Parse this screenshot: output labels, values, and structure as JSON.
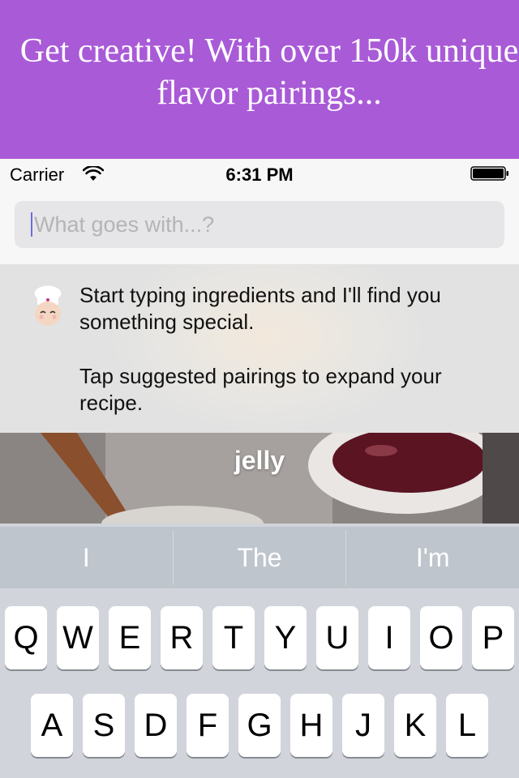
{
  "banner": {
    "text": "Get creative! With over 150k unique flavor pairings..."
  },
  "status_bar": {
    "carrier": "Carrier",
    "time": "6:31 PM"
  },
  "search": {
    "placeholder": "What goes with...?",
    "value": ""
  },
  "hint": {
    "line1": "Start typing ingredients and I'll find you something special.",
    "line2": "Tap suggested pairings to expand your recipe."
  },
  "pairing": {
    "label": "jelly"
  },
  "suggestions": [
    "I",
    "The",
    "I'm"
  ],
  "keyboard": {
    "row1": [
      "Q",
      "W",
      "E",
      "R",
      "T",
      "Y",
      "U",
      "I",
      "O",
      "P"
    ],
    "row2": [
      "A",
      "S",
      "D",
      "F",
      "G",
      "H",
      "J",
      "K",
      "L"
    ]
  },
  "colors": {
    "banner": "#a95ad7",
    "suggestion_bar": "#bfc5cd",
    "keyboard": "#d1d4db"
  }
}
